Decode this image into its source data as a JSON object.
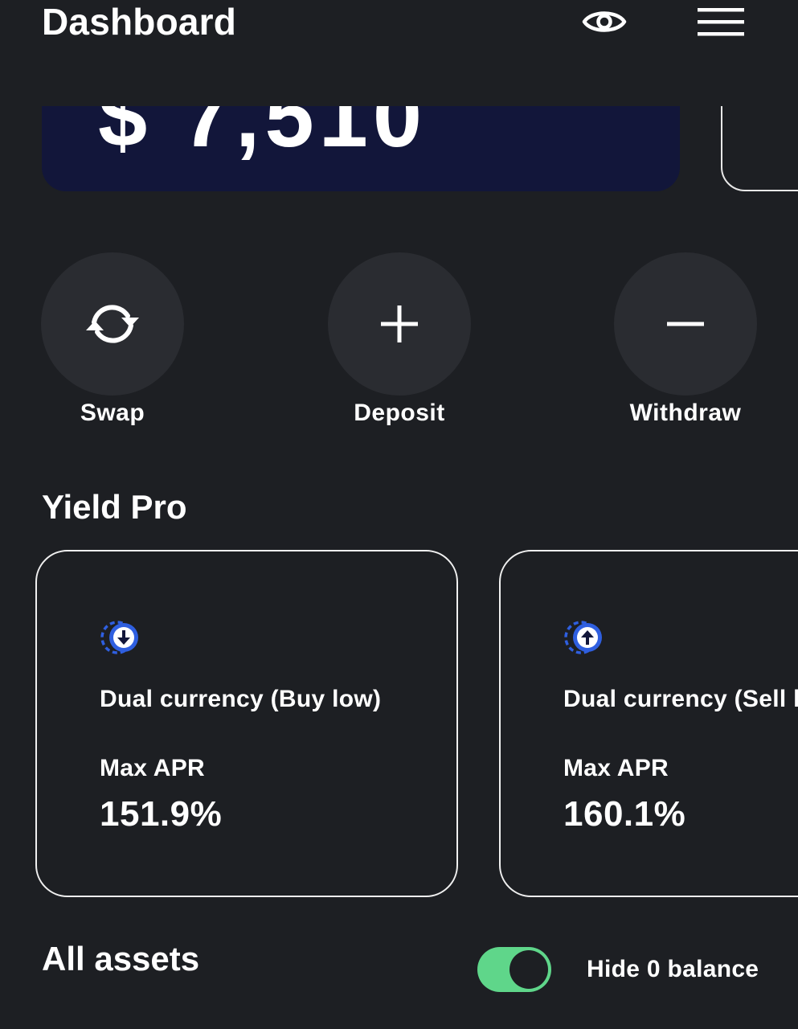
{
  "header": {
    "title": "Dashboard",
    "eye_icon": "eye-icon",
    "menu_icon": "hamburger-menu-icon"
  },
  "balance": {
    "partial_text": "$ 7,510"
  },
  "actions": [
    {
      "label": "Swap",
      "icon": "refresh-icon"
    },
    {
      "label": "Deposit",
      "icon": "plus-icon"
    },
    {
      "label": "Withdraw",
      "icon": "minus-icon"
    }
  ],
  "yield_pro": {
    "title": "Yield Pro",
    "cards": [
      {
        "name": "Dual currency (Buy low)",
        "apr_label": "Max APR",
        "apr_value": "151.9%",
        "icon": "arrow-down-circle-icon"
      },
      {
        "name": "Dual currency (Sell high)",
        "apr_label": "Max APR",
        "apr_value": "160.1%",
        "icon": "arrow-up-circle-icon"
      }
    ]
  },
  "assets": {
    "title": "All assets",
    "hide_zero_label": "Hide 0 balance",
    "hide_zero_enabled": true
  },
  "colors": {
    "background": "#1d1f23",
    "balance_card": "#12163a",
    "toggle_on": "#5fd68a",
    "icon_blue": "#2f5fe0",
    "action_circle": "#2a2c31"
  }
}
